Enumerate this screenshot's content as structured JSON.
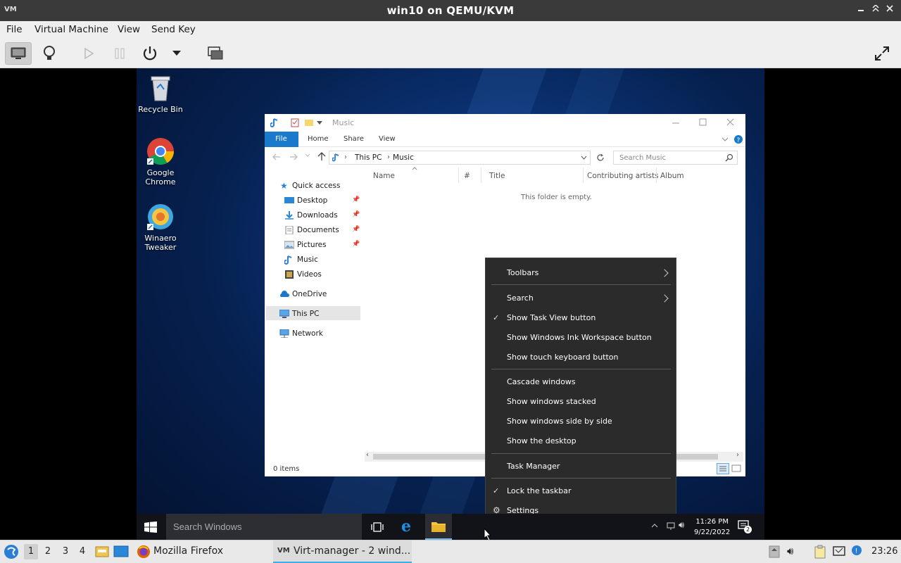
{
  "vm_window": {
    "title": "win10 on QEMU/KVM",
    "logo_text": "VM",
    "menu": [
      "File",
      "Virtual Machine",
      "View",
      "Send Key"
    ]
  },
  "desktop_icons": [
    {
      "label": "Recycle Bin",
      "icon": "recycle-bin-icon"
    },
    {
      "label": "Google Chrome",
      "icon": "chrome-icon"
    },
    {
      "label": "Winaero Tweaker",
      "icon": "winaero-icon"
    }
  ],
  "explorer": {
    "title": "Music",
    "ribbon_tabs": [
      "File",
      "Home",
      "Share",
      "View"
    ],
    "breadcrumb": [
      "This PC",
      "Music"
    ],
    "search_placeholder": "Search Music",
    "nav_items": [
      {
        "label": "Quick access",
        "icon": "star-icon",
        "pinned": false
      },
      {
        "label": "Desktop",
        "icon": "desktop-icon",
        "pinned": true
      },
      {
        "label": "Downloads",
        "icon": "download-icon",
        "pinned": true
      },
      {
        "label": "Documents",
        "icon": "documents-icon",
        "pinned": true
      },
      {
        "label": "Pictures",
        "icon": "pictures-icon",
        "pinned": true
      },
      {
        "label": "Music",
        "icon": "music-icon",
        "pinned": false
      },
      {
        "label": "Videos",
        "icon": "videos-icon",
        "pinned": false
      },
      {
        "label": "OneDrive",
        "icon": "onedrive-icon",
        "pinned": false
      },
      {
        "label": "This PC",
        "icon": "this-pc-icon",
        "pinned": false
      },
      {
        "label": "Network",
        "icon": "network-icon",
        "pinned": false
      }
    ],
    "columns": [
      "Name",
      "#",
      "Title",
      "Contributing artists",
      "Album"
    ],
    "empty_message": "This folder is empty.",
    "status": "0 items"
  },
  "context_menu": {
    "items": [
      {
        "label": "Toolbars",
        "submenu": true,
        "checked": false
      },
      {
        "label": "Search",
        "submenu": true,
        "checked": false
      },
      {
        "label": "Show Task View button",
        "submenu": false,
        "checked": true
      },
      {
        "label": "Show Windows Ink Workspace button",
        "submenu": false,
        "checked": false
      },
      {
        "label": "Show touch keyboard button",
        "submenu": false,
        "checked": false
      },
      {
        "label": "Cascade windows",
        "submenu": false,
        "checked": false
      },
      {
        "label": "Show windows stacked",
        "submenu": false,
        "checked": false
      },
      {
        "label": "Show windows side by side",
        "submenu": false,
        "checked": false
      },
      {
        "label": "Show the desktop",
        "submenu": false,
        "checked": false
      },
      {
        "label": "Task Manager",
        "submenu": false,
        "checked": false
      },
      {
        "label": "Lock the taskbar",
        "submenu": false,
        "checked": true
      },
      {
        "label": "Settings",
        "submenu": false,
        "checked": false,
        "icon": "gear-icon"
      }
    ]
  },
  "guest_taskbar": {
    "search_placeholder": "Search Windows",
    "time": "11:26 PM",
    "date": "9/22/2022",
    "notification_count": "2"
  },
  "host_panel": {
    "workspaces": [
      "1",
      "2",
      "3",
      "4"
    ],
    "current_workspace": "1",
    "tasks": [
      "Mozilla Firefox",
      "Virt-manager - 2 wind..."
    ],
    "clock": "23:26"
  },
  "colors": {
    "accent": "#1979ca",
    "host_task_accent": "#3daee9",
    "context_menu_bg": "#2b2b2b"
  }
}
